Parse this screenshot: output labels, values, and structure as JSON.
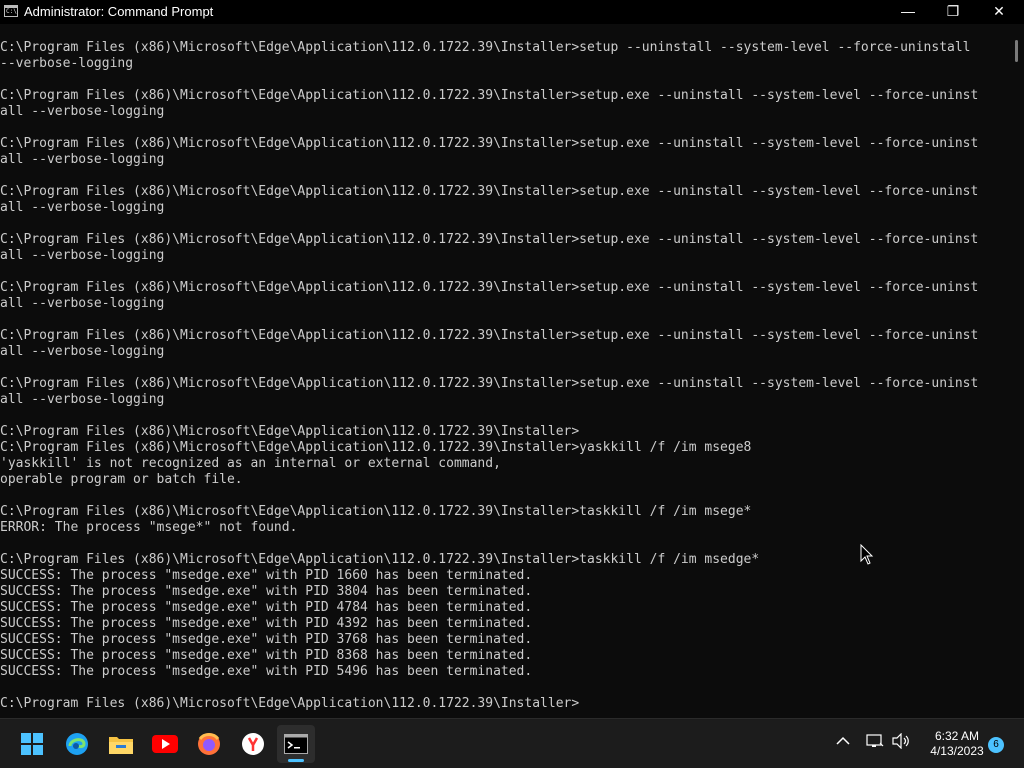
{
  "window": {
    "title": "Administrator: Command Prompt",
    "app_icon_text": "C:\\",
    "minimize_glyph": "—",
    "maximize_glyph": "❐",
    "close_glyph": "✕"
  },
  "terminal": {
    "lines": [
      "C:\\Program Files (x86)\\Microsoft\\Edge\\Application\\112.0.1722.39\\Installer>setup --uninstall --system-level --force-uninstall",
      "--verbose-logging",
      "",
      "C:\\Program Files (x86)\\Microsoft\\Edge\\Application\\112.0.1722.39\\Installer>setup.exe --uninstall --system-level --force-uninst",
      "all --verbose-logging",
      "",
      "C:\\Program Files (x86)\\Microsoft\\Edge\\Application\\112.0.1722.39\\Installer>setup.exe --uninstall --system-level --force-uninst",
      "all --verbose-logging",
      "",
      "C:\\Program Files (x86)\\Microsoft\\Edge\\Application\\112.0.1722.39\\Installer>setup.exe --uninstall --system-level --force-uninst",
      "all --verbose-logging",
      "",
      "C:\\Program Files (x86)\\Microsoft\\Edge\\Application\\112.0.1722.39\\Installer>setup.exe --uninstall --system-level --force-uninst",
      "all --verbose-logging",
      "",
      "C:\\Program Files (x86)\\Microsoft\\Edge\\Application\\112.0.1722.39\\Installer>setup.exe --uninstall --system-level --force-uninst",
      "all --verbose-logging",
      "",
      "C:\\Program Files (x86)\\Microsoft\\Edge\\Application\\112.0.1722.39\\Installer>setup.exe --uninstall --system-level --force-uninst",
      "all --verbose-logging",
      "",
      "C:\\Program Files (x86)\\Microsoft\\Edge\\Application\\112.0.1722.39\\Installer>setup.exe --uninstall --system-level --force-uninst",
      "all --verbose-logging",
      "",
      "C:\\Program Files (x86)\\Microsoft\\Edge\\Application\\112.0.1722.39\\Installer>",
      "C:\\Program Files (x86)\\Microsoft\\Edge\\Application\\112.0.1722.39\\Installer>yaskkill /f /im msege8",
      "'yaskkill' is not recognized as an internal or external command,",
      "operable program or batch file.",
      "",
      "C:\\Program Files (x86)\\Microsoft\\Edge\\Application\\112.0.1722.39\\Installer>taskkill /f /im msege*",
      "ERROR: The process \"msege*\" not found.",
      "",
      "C:\\Program Files (x86)\\Microsoft\\Edge\\Application\\112.0.1722.39\\Installer>taskkill /f /im msedge*",
      "SUCCESS: The process \"msedge.exe\" with PID 1660 has been terminated.",
      "SUCCESS: The process \"msedge.exe\" with PID 3804 has been terminated.",
      "SUCCESS: The process \"msedge.exe\" with PID 4784 has been terminated.",
      "SUCCESS: The process \"msedge.exe\" with PID 4392 has been terminated.",
      "SUCCESS: The process \"msedge.exe\" with PID 3768 has been terminated.",
      "SUCCESS: The process \"msedge.exe\" with PID 8368 has been terminated.",
      "SUCCESS: The process \"msedge.exe\" with PID 5496 has been terminated.",
      "",
      "C:\\Program Files (x86)\\Microsoft\\Edge\\Application\\112.0.1722.39\\Installer>"
    ]
  },
  "taskbar": {
    "apps": [
      {
        "icon": "windows-start-icon",
        "color": "#4cc2ff"
      },
      {
        "icon": "edge-icon",
        "color": "#1da1f2"
      },
      {
        "icon": "file-explorer-icon",
        "color": "#f6c343"
      },
      {
        "icon": "youtube-icon",
        "color": "#ff0000"
      },
      {
        "icon": "firefox-icon",
        "color": "#ff7139"
      },
      {
        "icon": "yandex-browser-icon",
        "color": "#ffffff"
      },
      {
        "icon": "command-prompt-icon",
        "color": "#000000",
        "active": true
      }
    ],
    "tray": {
      "chevron_glyph": "^",
      "network_icon": "network-icon",
      "volume_icon": "volume-icon"
    },
    "clock": {
      "time": "6:32 AM",
      "date": "4/13/2023"
    },
    "notification_count": "6"
  },
  "colors": {
    "terminal_bg": "#0c0c0c",
    "terminal_fg": "#cccccc",
    "taskbar_bg": "#1c1c1c",
    "accent": "#4cc2ff"
  }
}
